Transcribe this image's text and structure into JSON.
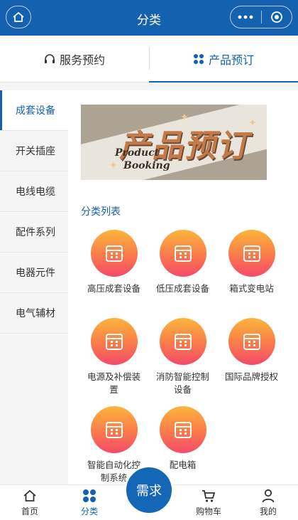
{
  "header": {
    "title": "分类"
  },
  "tabs": [
    {
      "label": "服务预约",
      "icon": "headset-icon"
    },
    {
      "label": "产品预订",
      "icon": "grid-icon"
    }
  ],
  "sidebar": {
    "items": [
      {
        "label": "成套设备",
        "active": true
      },
      {
        "label": "开关插座"
      },
      {
        "label": "电线电缆"
      },
      {
        "label": "配件系列"
      },
      {
        "label": "电器元件"
      },
      {
        "label": "电气辅材"
      }
    ]
  },
  "banner": {
    "title": "产品预订",
    "en_line1": "Product",
    "en_line2": "Booking"
  },
  "section_title": "分类列表",
  "categories": [
    {
      "label": "高压成套设备"
    },
    {
      "label": "低压成套设备"
    },
    {
      "label": "箱式变电站"
    },
    {
      "label": "电源及补偿装置"
    },
    {
      "label": "消防智能控制设备"
    },
    {
      "label": "国际品牌授权"
    },
    {
      "label": "智能自动化控制系统"
    },
    {
      "label": "配电箱"
    }
  ],
  "bottom_nav": [
    {
      "label": "首页",
      "icon": "home-icon"
    },
    {
      "label": "分类",
      "icon": "grid-icon",
      "active": true
    },
    {
      "label": "需求",
      "icon": ""
    },
    {
      "label": "购物车",
      "icon": "cart-icon"
    },
    {
      "label": "我的",
      "icon": "user-icon"
    }
  ],
  "colors": {
    "primary": "#1461b0",
    "gradient_top": "#fbb53b",
    "gradient_bottom": "#f44a6b"
  }
}
